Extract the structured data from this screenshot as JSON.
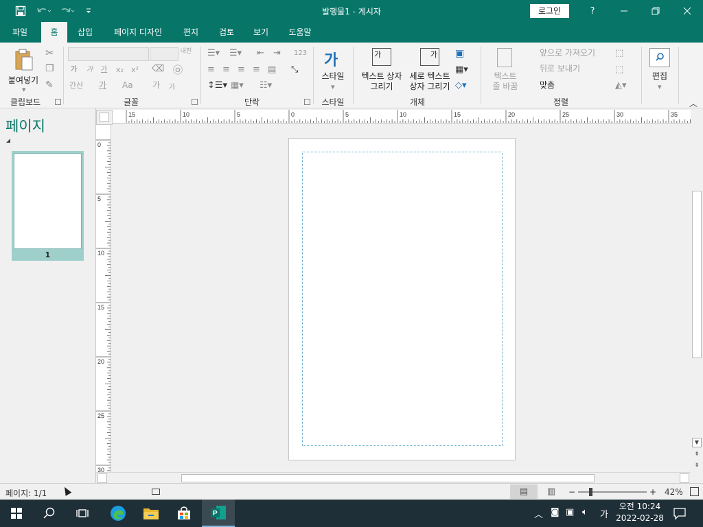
{
  "titlebar": {
    "title": "발행물1  -  게시자",
    "login": "로그인",
    "help": "?",
    "qat": {
      "save_icon": "save-icon",
      "undo_icon": "undo-icon",
      "redo_icon": "redo-icon"
    }
  },
  "tabs": [
    "파일",
    "홈",
    "삽입",
    "페이지 디자인",
    "편지",
    "검토",
    "보기",
    "도움말"
  ],
  "active_tab": "홈",
  "ribbon": {
    "clipboard": {
      "paste": "붙여넣기",
      "label": "클립보드"
    },
    "font": {
      "label": "글꼴",
      "bold": "가",
      "italic": "가",
      "underline": "가",
      "sub": "x₂",
      "sup": "x²",
      "spacing": "간산",
      "color": "가",
      "case": "Aa",
      "grow": "가",
      "shrink": "가",
      "size_tag": "내친"
    },
    "paragraph": {
      "label": "단락",
      "num": "123"
    },
    "styles": {
      "button": "스타일",
      "label": "스타일",
      "glyph": "가"
    },
    "objects": {
      "textbox": "텍스트 상자\n그리기",
      "vtextbox": "세로 텍스트\n상자 그리기",
      "label": "개체",
      "textbox_glyph": "가",
      "vtextbox_glyph": "가"
    },
    "arrange": {
      "wrap": "텍스트\n줄 바꿈",
      "bring_forward": "앞으로 가져오기",
      "send_backward": "뒤로 보내기",
      "align": "맞춤",
      "label": "정렬"
    },
    "editing": {
      "button": "편집"
    }
  },
  "pages_pane": {
    "title": "페이지",
    "pages": [
      {
        "number": "1"
      }
    ]
  },
  "ruler": {
    "top_labels": [
      "15",
      "10",
      "5",
      "0",
      "5",
      "10",
      "15",
      "20",
      "25",
      "30",
      "35"
    ],
    "left_labels": [
      "0",
      "5",
      "10",
      "15",
      "20",
      "25",
      "30"
    ]
  },
  "status": {
    "page": "페이지: 1/1",
    "zoom": "42%",
    "zoom_minus": "−",
    "zoom_plus": "+",
    "zoom_level": 0.42
  },
  "taskbar": {
    "time": "오전 10:24",
    "date": "2022-02-28",
    "ime": "가",
    "apps": [
      "start-icon",
      "search-icon",
      "task-view-icon",
      "edge-icon",
      "file-explorer-icon",
      "store-icon",
      "publisher-icon"
    ]
  },
  "colors": {
    "accent": "#077568",
    "taskbar": "#1f2f37"
  }
}
